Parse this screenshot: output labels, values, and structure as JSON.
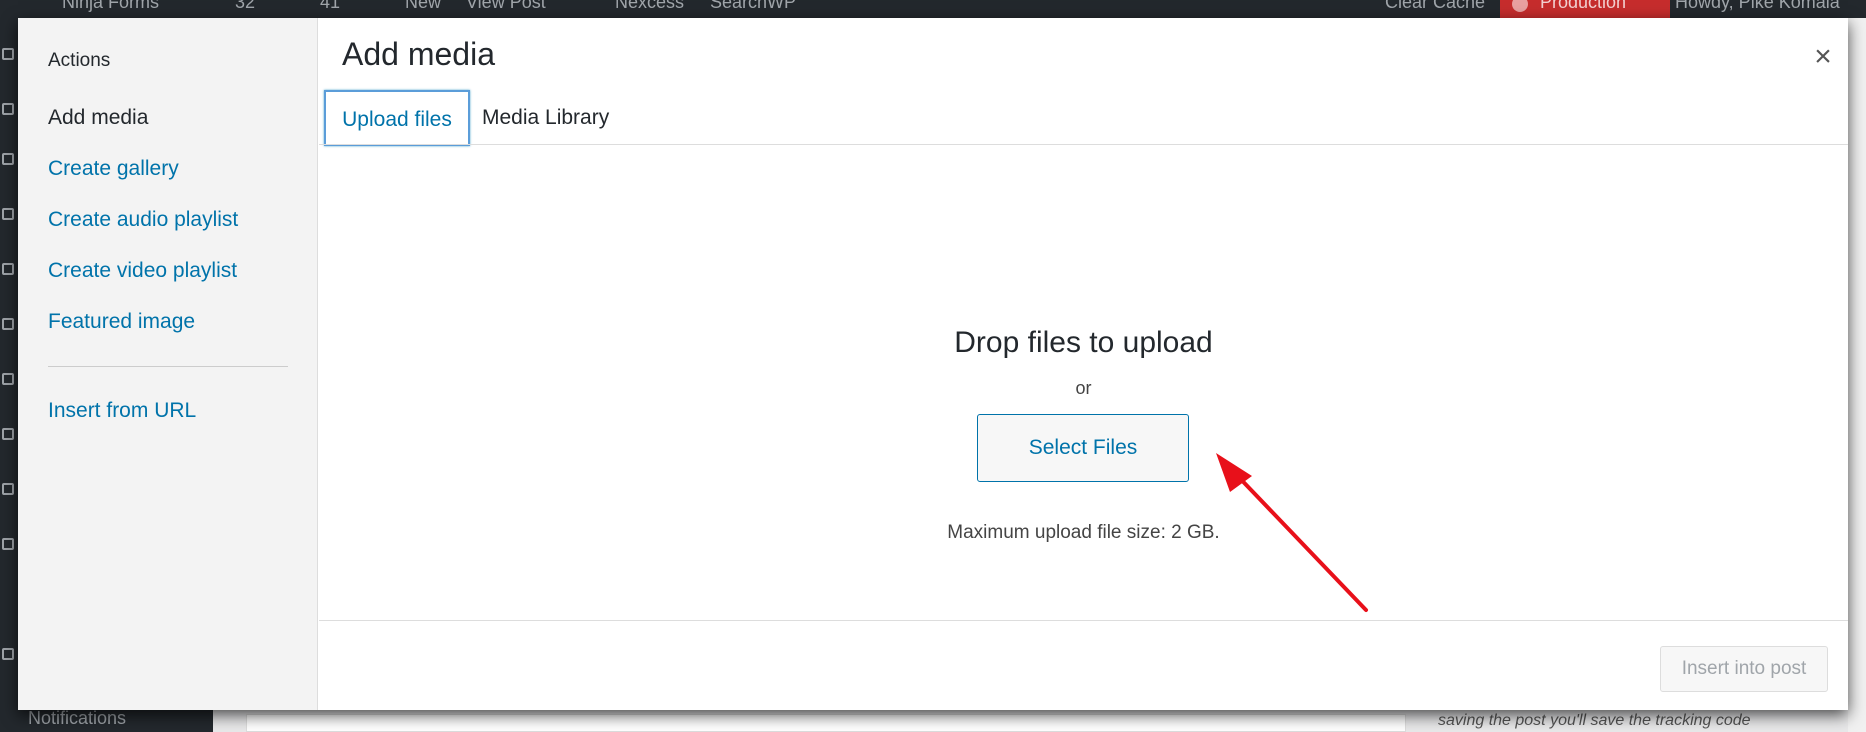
{
  "admin_bar": {
    "items": [
      "Ninja Forms",
      "32",
      "41",
      "New",
      "View Post",
      "Nexcess",
      "SearchWP"
    ],
    "right_items": [
      "Clear Cache",
      "Production",
      "Howdy, Pike Komala"
    ]
  },
  "background": {
    "notifications_label": "Notifications",
    "right_text": "saving the post you'll save the tracking code"
  },
  "modal": {
    "title": "Add media",
    "close_glyph": "×",
    "sidebar": {
      "heading": "Actions",
      "items": [
        {
          "label": "Add media",
          "active": true
        },
        {
          "label": "Create gallery"
        },
        {
          "label": "Create audio playlist"
        },
        {
          "label": "Create video playlist"
        },
        {
          "label": "Featured image"
        }
      ],
      "extra_items": [
        {
          "label": "Insert from URL"
        }
      ]
    },
    "tabs": [
      {
        "label": "Upload files",
        "active": true
      },
      {
        "label": "Media Library"
      }
    ],
    "upload": {
      "drop_title": "Drop files to upload",
      "or_text": "or",
      "select_button": "Select Files",
      "max_size": "Maximum upload file size: 2 GB."
    },
    "toolbar": {
      "insert_button": "Insert into post"
    }
  },
  "colors": {
    "link": "#0073aa",
    "annotation_arrow": "#e8101a",
    "admin_bar": "#23282d"
  }
}
